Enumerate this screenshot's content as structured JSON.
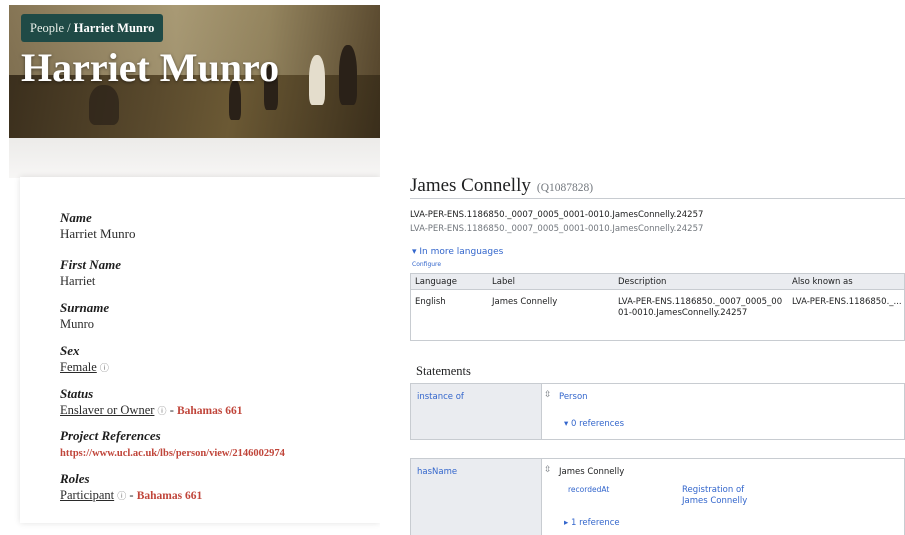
{
  "person_page": {
    "breadcrumb": {
      "root": "People",
      "separator": " / ",
      "current": "Harriet Munro"
    },
    "title": "Harriet Munro",
    "fields": {
      "name": {
        "label": "Name",
        "value": "Harriet Munro"
      },
      "first_name": {
        "label": "First Name",
        "value": "Harriet"
      },
      "surname": {
        "label": "Surname",
        "value": "Munro"
      },
      "sex": {
        "label": "Sex",
        "value": "Female"
      },
      "status": {
        "label": "Status",
        "value": "Enslaver or Owner",
        "separator": " - ",
        "link": "Bahamas 661"
      },
      "project_references": {
        "label": "Project References",
        "link": "https://www.ucl.ac.uk/lbs/person/view/2146002974"
      },
      "roles": {
        "label": "Roles",
        "value": "Participant",
        "separator": " - ",
        "link": "Bahamas 661"
      }
    },
    "icons": {
      "info": "info-icon"
    },
    "colors": {
      "breadcrumb_bg": "#1f4a46",
      "link_red": "#c0453a"
    }
  },
  "wikibase_item": {
    "label": "James Connelly",
    "id": "(Q1087828)",
    "description": "LVA-PER-ENS.1186850._0007_0005_0001-0010.JamesConnelly.24257",
    "alias_line": "LVA-PER-ENS.1186850._0007_0005_0001-0010.JamesConnelly.24257",
    "more_languages": "▾ In more languages",
    "configure": "Configure",
    "lang_table": {
      "headers": [
        "Language",
        "Label",
        "Description",
        "Also known as"
      ],
      "row": {
        "language": "English",
        "label": "James Connelly",
        "description": "LVA-PER-ENS.1186850._0007_0005_0001-0010.JamesConnelly.24257",
        "also_known_as": "LVA-PER-ENS.1186850._..."
      }
    },
    "statements_title": "Statements",
    "statements": [
      {
        "property": "instance of",
        "value": "Person",
        "references": "▾ 0 references"
      },
      {
        "property": "hasName",
        "value": "James Connelly",
        "qualifier": "recordedAt",
        "qualifier_value": "Registration of James Connelly",
        "references": "▸ 1 reference"
      }
    ],
    "colors": {
      "link": "#3366cc",
      "header_bg": "#eaecf0",
      "border": "#c8ccd1"
    }
  }
}
